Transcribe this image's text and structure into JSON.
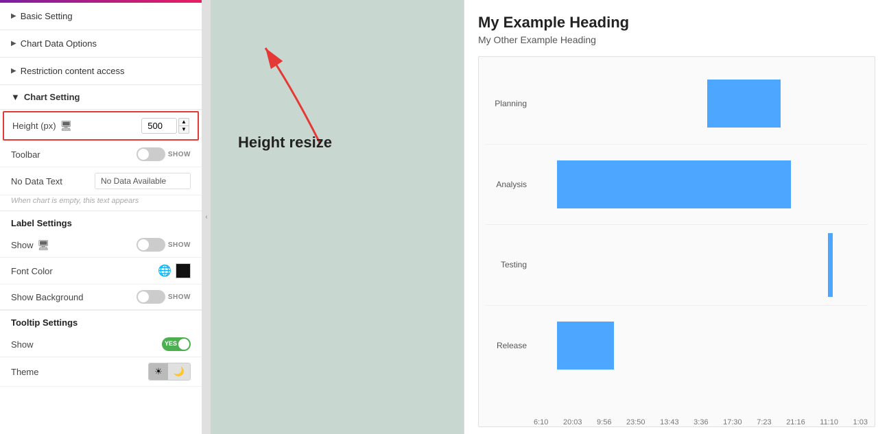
{
  "sidebar": {
    "top_bar_color": "#9c27b0",
    "sections": [
      {
        "id": "basic-setting",
        "label": "Basic Setting",
        "arrow": "▶",
        "expanded": false
      },
      {
        "id": "chart-data-options",
        "label": "Chart Data Options",
        "arrow": "▶",
        "expanded": false
      },
      {
        "id": "restriction",
        "label": "Restriction content access",
        "arrow": "▶",
        "expanded": false
      },
      {
        "id": "chart-setting",
        "label": "Chart Setting",
        "arrow": "▼",
        "expanded": true
      }
    ],
    "chart_setting": {
      "height_label": "Height (px)",
      "height_value": "500",
      "toolbar_label": "Toolbar",
      "toolbar_show": "SHOW",
      "no_data_label": "No Data Text",
      "no_data_value": "No Data Available",
      "no_data_hint": "When chart is empty, this text appears"
    },
    "label_settings": {
      "title": "Label Settings",
      "show_label": "Show",
      "show_toggle": "SHOW",
      "font_color_label": "Font Color",
      "show_bg_label": "Show Background",
      "show_bg_toggle": "SHOW"
    },
    "tooltip_settings": {
      "title": "Tooltip Settings",
      "show_label": "Show",
      "show_toggle_on": "YES",
      "theme_label": "Theme"
    }
  },
  "annotation": {
    "text": "Height resize"
  },
  "chart": {
    "heading_main": "My Example Heading",
    "heading_sub": "My Other Example Heading",
    "rows": [
      {
        "label": "Planning",
        "bar_left_pct": 52,
        "bar_width_pct": 22
      },
      {
        "label": "Analysis",
        "bar_left_pct": 7,
        "bar_width_pct": 70
      },
      {
        "label": "Testing",
        "bar_left_pct": 88,
        "bar_width_pct": 2
      },
      {
        "label": "Release",
        "bar_left_pct": 7,
        "bar_width_pct": 17
      }
    ],
    "x_labels": [
      "6:10",
      "20:03",
      "9:56",
      "23:50",
      "13:43",
      "3:36",
      "17:30",
      "7:23",
      "21:16",
      "11:10",
      "1:03"
    ]
  }
}
